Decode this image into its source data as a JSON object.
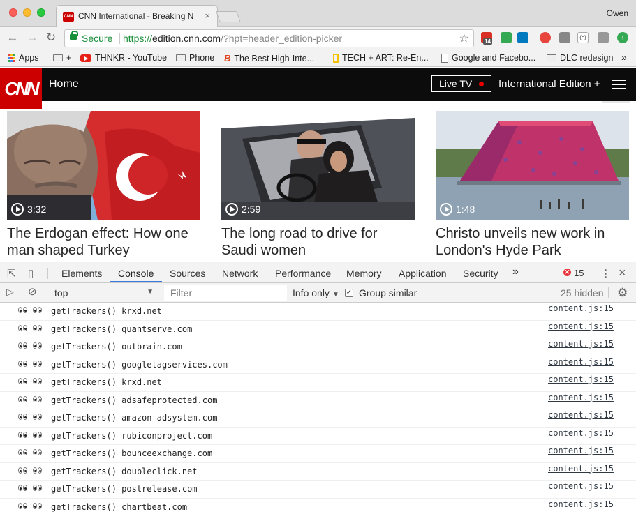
{
  "browser": {
    "tab": {
      "favicon_text": "CNN",
      "title": "CNN International - Breaking N",
      "close": "×"
    },
    "profile": "Owen",
    "address": {
      "secure_label": "Secure",
      "scheme": "https://",
      "host": "edition.cnn.com",
      "path": "/?hpt=header_edition-picker"
    },
    "extensions": [
      {
        "name": "extension-red-badge-icon",
        "color": "#d93025",
        "badge": "14"
      },
      {
        "name": "extension-green-icon",
        "color": "#34a853"
      },
      {
        "name": "trello-icon",
        "color": "#0079bf"
      },
      {
        "name": "ublock-icon",
        "color": "#e8453c"
      },
      {
        "name": "readability-icon",
        "color": "#888888"
      },
      {
        "name": "json-viewer-icon",
        "color": "#ffffff"
      },
      {
        "name": "evernote-icon",
        "color": "#999999"
      },
      {
        "name": "update-arrow-icon",
        "color": "#34a853"
      }
    ],
    "bookmarks": [
      {
        "icon": "apps-icon",
        "label": "Apps"
      },
      {
        "icon": "folder-icon",
        "label": "+"
      },
      {
        "icon": "youtube-icon",
        "label": "THNKR - YouTube"
      },
      {
        "icon": "folder-icon",
        "label": "Phone"
      },
      {
        "icon": "b-icon",
        "label": "The Best High-Inte..."
      },
      {
        "icon": "yellow-doc-icon",
        "label": "TECH + ART: Re-En..."
      },
      {
        "icon": "doc-icon",
        "label": "Google and Facebo..."
      },
      {
        "icon": "folder-icon",
        "label": "DLC redesign"
      }
    ],
    "bookmarks_overflow": "»"
  },
  "cnn": {
    "logo": "CNN",
    "home": "Home",
    "live_tv": "Live TV",
    "edition": "International Edition +",
    "cards": [
      {
        "duration": "3:32",
        "headline": "The Erdogan effect: How one man shaped Turkey"
      },
      {
        "duration": "2:59",
        "headline": "The long road to drive for Saudi women"
      },
      {
        "duration": "1:48",
        "headline": "Christo unveils new work in London's Hyde Park"
      }
    ]
  },
  "devtools": {
    "tabs": [
      "Elements",
      "Console",
      "Sources",
      "Network",
      "Performance",
      "Memory",
      "Application",
      "Security"
    ],
    "active_tab": "Console",
    "more_tabs": "»",
    "error_count": "15",
    "error_badge": "✕",
    "context": "top",
    "filter_placeholder": "Filter",
    "levels": "Info only",
    "group_similar": "Group similar",
    "hidden": "25 hidden",
    "messages": [
      {
        "text": "getTrackers() krxd.net",
        "source": "content.js:15"
      },
      {
        "text": "getTrackers() quantserve.com",
        "source": "content.js:15"
      },
      {
        "text": "getTrackers() outbrain.com",
        "source": "content.js:15"
      },
      {
        "text": "getTrackers() googletagservices.com",
        "source": "content.js:15"
      },
      {
        "text": "getTrackers() krxd.net",
        "source": "content.js:15"
      },
      {
        "text": "getTrackers() adsafeprotected.com",
        "source": "content.js:15"
      },
      {
        "text": "getTrackers() amazon-adsystem.com",
        "source": "content.js:15"
      },
      {
        "text": "getTrackers() rubiconproject.com",
        "source": "content.js:15"
      },
      {
        "text": "getTrackers() bounceexchange.com",
        "source": "content.js:15"
      },
      {
        "text": "getTrackers() doubleclick.net",
        "source": "content.js:15"
      },
      {
        "text": "getTrackers() postrelease.com",
        "source": "content.js:15"
      },
      {
        "text": "getTrackers() chartbeat.com",
        "source": "content.js:15"
      }
    ]
  }
}
